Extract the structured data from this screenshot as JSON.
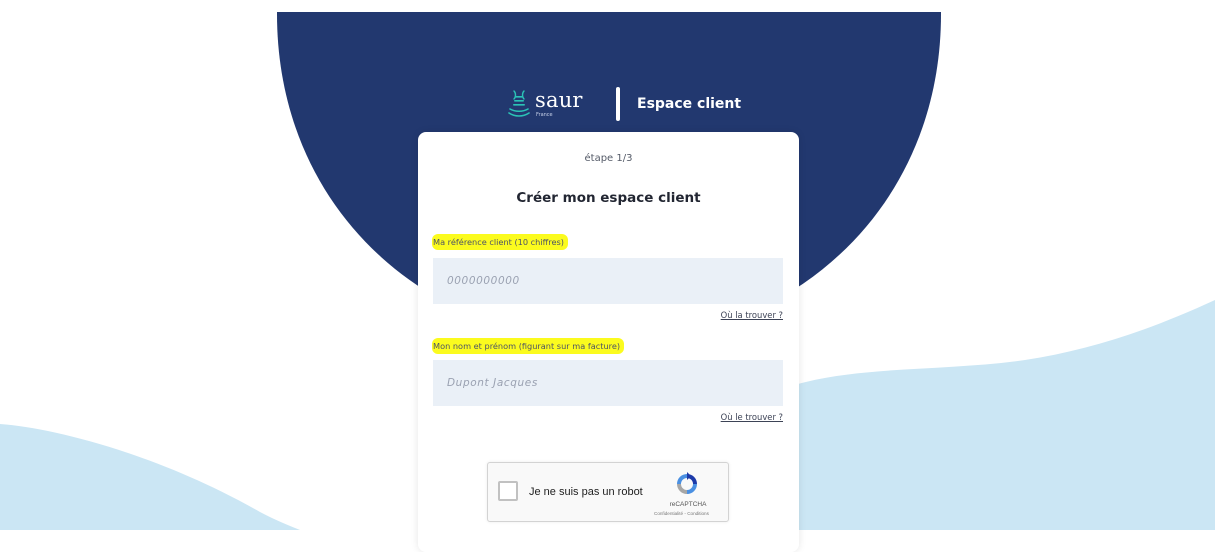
{
  "brand": {
    "wordmark": "saur",
    "country": "France",
    "title": "Espace client"
  },
  "form": {
    "step": "étape 1/3",
    "title": "Créer mon espace client",
    "reference_label": "Ma référence client (10 chiffres)",
    "reference_placeholder": "0000000000",
    "reference_help": "Où la trouver ?",
    "name_label": "Mon nom et prénom (figurant sur ma facture)",
    "name_placeholder": "Dupont Jacques",
    "name_help": "Où le trouver ?"
  },
  "captcha": {
    "label": "Je ne suis pas un robot",
    "brand": "reCAPTCHA",
    "terms": "Confidentialité - Conditions"
  },
  "colors": {
    "navy": "#22386f",
    "light_blue": "#cbe6f4",
    "accent_teal": "#2bc2b6",
    "highlight": "#fbfb1e"
  },
  "icons": {
    "logo": "saur-wave-icon",
    "captcha": "recaptcha-icon"
  }
}
